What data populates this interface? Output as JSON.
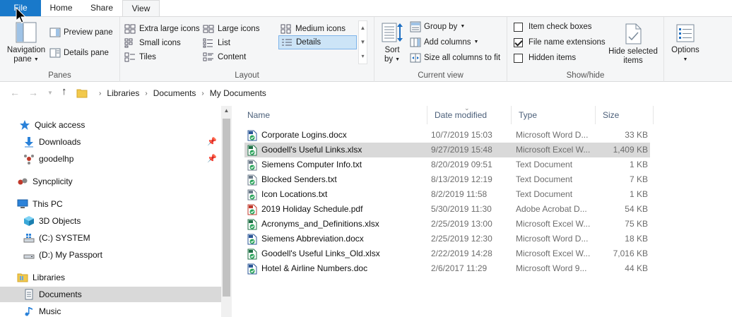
{
  "tabs": [
    {
      "label": "File"
    },
    {
      "label": "Home"
    },
    {
      "label": "Share"
    },
    {
      "label": "View"
    }
  ],
  "ribbon": {
    "panes": {
      "label": "Panes",
      "navigation_pane": "Navigation",
      "navigation_pane_line2": "pane",
      "preview_pane": "Preview pane",
      "details_pane": "Details pane"
    },
    "layout": {
      "label": "Layout",
      "items": [
        {
          "label": "Extra large icons"
        },
        {
          "label": "Large icons"
        },
        {
          "label": "Medium icons"
        },
        {
          "label": "Small icons"
        },
        {
          "label": "List"
        },
        {
          "label": "Details"
        },
        {
          "label": "Tiles"
        },
        {
          "label": "Content"
        }
      ],
      "selected": "Details"
    },
    "current_view": {
      "label": "Current view",
      "sort_by": "Sort",
      "sort_by_line2": "by",
      "group_by": "Group by",
      "add_columns": "Add columns",
      "size_all_columns": "Size all columns to fit"
    },
    "show_hide": {
      "label": "Show/hide",
      "item_check_boxes": "Item check boxes",
      "item_check_boxes_checked": false,
      "file_name_extensions": "File name extensions",
      "file_name_extensions_checked": true,
      "hidden_items": "Hidden items",
      "hidden_items_checked": false,
      "hide_selected_items": "Hide selected",
      "hide_selected_items_line2": "items"
    },
    "options": {
      "label": "Options"
    }
  },
  "address": {
    "crumbs": [
      "Libraries",
      "Documents",
      "My Documents"
    ]
  },
  "nav": {
    "items": [
      {
        "label": "Quick access"
      },
      {
        "label": "Downloads"
      },
      {
        "label": "goodelhp"
      },
      {
        "label": "Syncplicity"
      },
      {
        "label": "This PC"
      },
      {
        "label": "3D Objects"
      },
      {
        "label": "(C:) SYSTEM"
      },
      {
        "label": "(D:) My Passport"
      },
      {
        "label": "Libraries"
      },
      {
        "label": "Documents"
      },
      {
        "label": "Music"
      }
    ]
  },
  "columns": {
    "name": "Name",
    "date": "Date modified",
    "type": "Type",
    "size": "Size"
  },
  "files": [
    {
      "name": "Corporate Logins.docx",
      "date": "10/7/2019 15:03",
      "type": "Microsoft Word D...",
      "size": "33 KB",
      "kind": "word"
    },
    {
      "name": "Goodell's Useful Links.xlsx",
      "date": "9/27/2019 15:48",
      "type": "Microsoft Excel W...",
      "size": "1,409 KB",
      "kind": "excel"
    },
    {
      "name": "Siemens Computer Info.txt",
      "date": "8/20/2019 09:51",
      "type": "Text Document",
      "size": "1 KB",
      "kind": "text"
    },
    {
      "name": "Blocked Senders.txt",
      "date": "8/13/2019 12:19",
      "type": "Text Document",
      "size": "7 KB",
      "kind": "text"
    },
    {
      "name": "Icon Locations.txt",
      "date": "8/2/2019 11:58",
      "type": "Text Document",
      "size": "1 KB",
      "kind": "text"
    },
    {
      "name": "2019 Holiday Schedule.pdf",
      "date": "5/30/2019 11:30",
      "type": "Adobe Acrobat D...",
      "size": "54 KB",
      "kind": "pdf"
    },
    {
      "name": "Acronyms_and_Definitions.xlsx",
      "date": "2/25/2019 13:00",
      "type": "Microsoft Excel W...",
      "size": "75 KB",
      "kind": "excel"
    },
    {
      "name": "Siemens Abbreviation.docx",
      "date": "2/25/2019 12:30",
      "type": "Microsoft Word D...",
      "size": "18 KB",
      "kind": "word"
    },
    {
      "name": "Goodell's Useful Links_Old.xlsx",
      "date": "2/22/2019 14:28",
      "type": "Microsoft Excel W...",
      "size": "7,016 KB",
      "kind": "excel"
    },
    {
      "name": "Hotel & Airline Numbers.doc",
      "date": "2/6/2017 11:29",
      "type": "Microsoft Word 9...",
      "size": "44 KB",
      "kind": "word"
    }
  ],
  "selected_file": "Goodell's Useful Links.xlsx",
  "colors": {
    "file_tab": "#1979ca",
    "selection": "#d9d9d9",
    "layout_selected": "#cce4f7",
    "sync_check": "#2ca55c",
    "column_header": "#4c607a"
  }
}
